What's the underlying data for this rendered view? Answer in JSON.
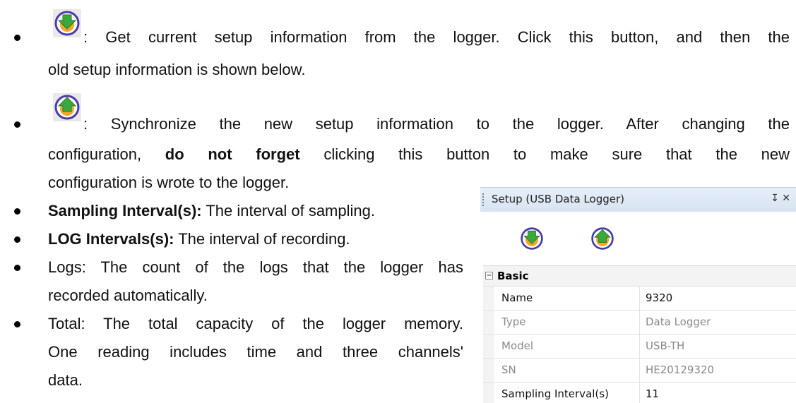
{
  "doc": {
    "item1": {
      "line1": ": Get current setup information from the logger. Click this button, and then the",
      "line2": "old setup information is shown below."
    },
    "item2": {
      "line1": ": Synchronize the new setup information to the logger. After changing the",
      "line2_pre": "configuration,",
      "line2_bold": "do not forget",
      "line2_post": "clicking this button to make sure that the new",
      "line3": "configuration is wrote to the logger."
    },
    "item3": {
      "bold": "Sampling Interval(s):",
      "text": "The interval of sampling."
    },
    "item4": {
      "bold": "LOG Intervals(s):",
      "text": "The interval of recording."
    },
    "item5": {
      "line1": "Logs: The count of the logs that the logger has",
      "line2": "recorded automatically."
    },
    "item6": {
      "line1": "Total: The total capacity of the logger memory.",
      "line2": "One reading includes time and three channels'",
      "line3": "data."
    }
  },
  "panel": {
    "title": "Setup (USB Data Logger)",
    "pin": " ✕",
    "category": "Basic",
    "toggle": "−",
    "rows": [
      {
        "key": "Name",
        "value": "9320"
      },
      {
        "key": "Type",
        "value": "Data Logger"
      },
      {
        "key": "Model",
        "value": "USB-TH"
      },
      {
        "key": "SN",
        "value": "HE20129320"
      },
      {
        "key": "Sampling Interval(s)",
        "value": "11"
      }
    ]
  },
  "icons": {
    "get": "download-arrow-icon",
    "sync": "upload-arrow-icon",
    "ring_color": "#4a3aa8",
    "fill_color": "#f5a623",
    "arrow_color": "#3aa83a"
  }
}
